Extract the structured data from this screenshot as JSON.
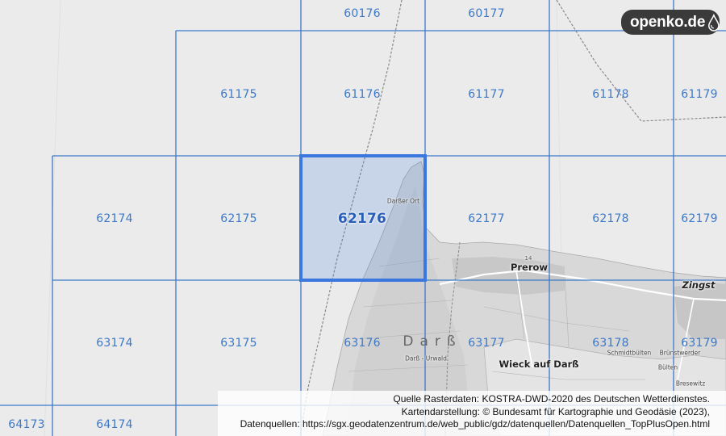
{
  "brand": {
    "name": "openko.de",
    "icon": "water-drop-icon"
  },
  "grid": {
    "line_color": "#3c78c8",
    "label_color": "#3c78c8",
    "selected_fill": "rgba(60,120,220,0.22)",
    "selected_label": "62176",
    "cells": [
      {
        "id": "60176"
      },
      {
        "id": "60177"
      },
      {
        "id": "61175"
      },
      {
        "id": "61176"
      },
      {
        "id": "61177"
      },
      {
        "id": "61178"
      },
      {
        "id": "61179"
      },
      {
        "id": "62174"
      },
      {
        "id": "62175"
      },
      {
        "id": "62176"
      },
      {
        "id": "62177"
      },
      {
        "id": "62178"
      },
      {
        "id": "62179"
      },
      {
        "id": "63174"
      },
      {
        "id": "63175"
      },
      {
        "id": "63176"
      },
      {
        "id": "63177"
      },
      {
        "id": "63178"
      },
      {
        "id": "63179"
      },
      {
        "id": "64173"
      },
      {
        "id": "64174"
      }
    ]
  },
  "places": {
    "darsser_ort": "Darßer Ort",
    "prerow": "Prerow",
    "zingst": "Zingst",
    "darss": "Darß",
    "darss_urwald": "Darß - Urwald",
    "wieck": "Wieck auf Darß",
    "schmidtbuelten": "Schmidtbülten",
    "bruenstwerder": "Brünstwerder",
    "bresewitz": "Bresewitz",
    "buelten": "Bülten",
    "marker_14": "14"
  },
  "attribution": {
    "line1": "Quelle Rasterdaten: KOSTRA-DWD-2020 des Deutschen Wetterdienstes.",
    "line2": "Kartendarstellung: © Bundesamt für Kartographie und Geodäsie (2023),",
    "line3": "Datenquellen: https://sgx.geodatenzentrum.de/web_public/gdz/datenquellen/Datenquellen_TopPlusOpen.html"
  }
}
